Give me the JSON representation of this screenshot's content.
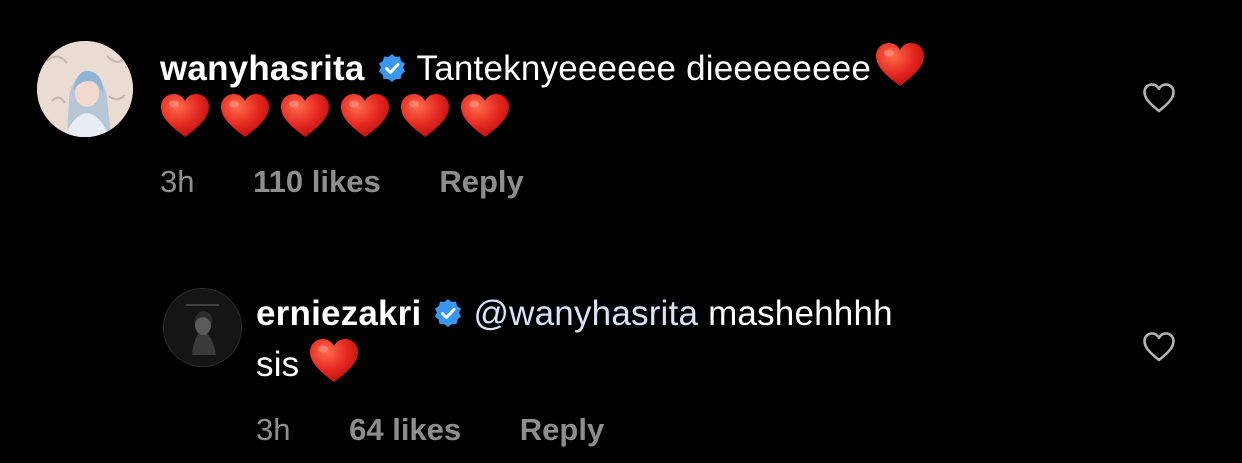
{
  "colors": {
    "background": "#000000",
    "text": "#ffffff",
    "meta_text": "#8e8e8e",
    "verified_badge": "#3897f0",
    "heart_emoji": "#e3261f"
  },
  "comments": [
    {
      "username": "wanyhasrita",
      "verified": true,
      "text_parts": [
        "Tanteknyeeeeee dieeeeeeee"
      ],
      "heart_emoji_count": 7,
      "time": "3h",
      "likes": "110 likes",
      "reply_label": "Reply",
      "like_icon": "heart-outline-icon"
    },
    {
      "username": "erniezakri",
      "verified": true,
      "mention": "@wanyhasrita",
      "text_parts": [
        "mashehhhh",
        "sis"
      ],
      "heart_emoji_count": 1,
      "time": "3h",
      "likes": "64 likes",
      "reply_label": "Reply",
      "like_icon": "heart-outline-icon"
    }
  ]
}
